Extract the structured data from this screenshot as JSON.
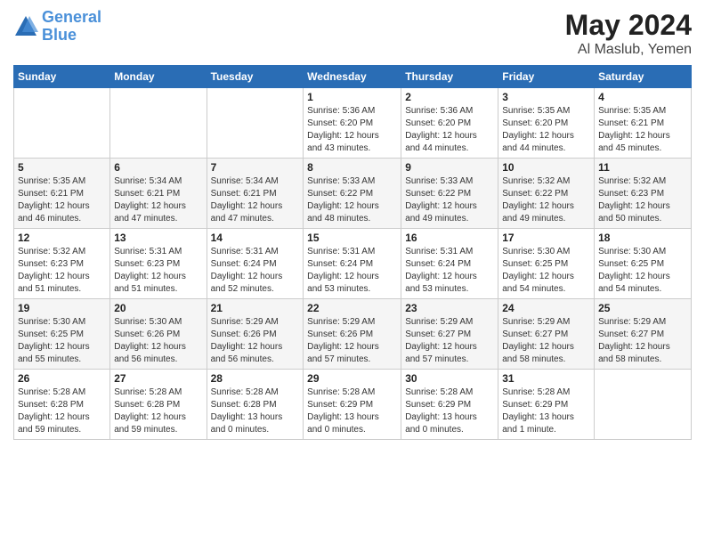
{
  "header": {
    "logo_line1": "General",
    "logo_line2": "Blue",
    "month": "May 2024",
    "location": "Al Maslub, Yemen"
  },
  "weekdays": [
    "Sunday",
    "Monday",
    "Tuesday",
    "Wednesday",
    "Thursday",
    "Friday",
    "Saturday"
  ],
  "weeks": [
    [
      {
        "day": "",
        "info": ""
      },
      {
        "day": "",
        "info": ""
      },
      {
        "day": "",
        "info": ""
      },
      {
        "day": "1",
        "info": "Sunrise: 5:36 AM\nSunset: 6:20 PM\nDaylight: 12 hours\nand 43 minutes."
      },
      {
        "day": "2",
        "info": "Sunrise: 5:36 AM\nSunset: 6:20 PM\nDaylight: 12 hours\nand 44 minutes."
      },
      {
        "day": "3",
        "info": "Sunrise: 5:35 AM\nSunset: 6:20 PM\nDaylight: 12 hours\nand 44 minutes."
      },
      {
        "day": "4",
        "info": "Sunrise: 5:35 AM\nSunset: 6:21 PM\nDaylight: 12 hours\nand 45 minutes."
      }
    ],
    [
      {
        "day": "5",
        "info": "Sunrise: 5:35 AM\nSunset: 6:21 PM\nDaylight: 12 hours\nand 46 minutes."
      },
      {
        "day": "6",
        "info": "Sunrise: 5:34 AM\nSunset: 6:21 PM\nDaylight: 12 hours\nand 47 minutes."
      },
      {
        "day": "7",
        "info": "Sunrise: 5:34 AM\nSunset: 6:21 PM\nDaylight: 12 hours\nand 47 minutes."
      },
      {
        "day": "8",
        "info": "Sunrise: 5:33 AM\nSunset: 6:22 PM\nDaylight: 12 hours\nand 48 minutes."
      },
      {
        "day": "9",
        "info": "Sunrise: 5:33 AM\nSunset: 6:22 PM\nDaylight: 12 hours\nand 49 minutes."
      },
      {
        "day": "10",
        "info": "Sunrise: 5:32 AM\nSunset: 6:22 PM\nDaylight: 12 hours\nand 49 minutes."
      },
      {
        "day": "11",
        "info": "Sunrise: 5:32 AM\nSunset: 6:23 PM\nDaylight: 12 hours\nand 50 minutes."
      }
    ],
    [
      {
        "day": "12",
        "info": "Sunrise: 5:32 AM\nSunset: 6:23 PM\nDaylight: 12 hours\nand 51 minutes."
      },
      {
        "day": "13",
        "info": "Sunrise: 5:31 AM\nSunset: 6:23 PM\nDaylight: 12 hours\nand 51 minutes."
      },
      {
        "day": "14",
        "info": "Sunrise: 5:31 AM\nSunset: 6:24 PM\nDaylight: 12 hours\nand 52 minutes."
      },
      {
        "day": "15",
        "info": "Sunrise: 5:31 AM\nSunset: 6:24 PM\nDaylight: 12 hours\nand 53 minutes."
      },
      {
        "day": "16",
        "info": "Sunrise: 5:31 AM\nSunset: 6:24 PM\nDaylight: 12 hours\nand 53 minutes."
      },
      {
        "day": "17",
        "info": "Sunrise: 5:30 AM\nSunset: 6:25 PM\nDaylight: 12 hours\nand 54 minutes."
      },
      {
        "day": "18",
        "info": "Sunrise: 5:30 AM\nSunset: 6:25 PM\nDaylight: 12 hours\nand 54 minutes."
      }
    ],
    [
      {
        "day": "19",
        "info": "Sunrise: 5:30 AM\nSunset: 6:25 PM\nDaylight: 12 hours\nand 55 minutes."
      },
      {
        "day": "20",
        "info": "Sunrise: 5:30 AM\nSunset: 6:26 PM\nDaylight: 12 hours\nand 56 minutes."
      },
      {
        "day": "21",
        "info": "Sunrise: 5:29 AM\nSunset: 6:26 PM\nDaylight: 12 hours\nand 56 minutes."
      },
      {
        "day": "22",
        "info": "Sunrise: 5:29 AM\nSunset: 6:26 PM\nDaylight: 12 hours\nand 57 minutes."
      },
      {
        "day": "23",
        "info": "Sunrise: 5:29 AM\nSunset: 6:27 PM\nDaylight: 12 hours\nand 57 minutes."
      },
      {
        "day": "24",
        "info": "Sunrise: 5:29 AM\nSunset: 6:27 PM\nDaylight: 12 hours\nand 58 minutes."
      },
      {
        "day": "25",
        "info": "Sunrise: 5:29 AM\nSunset: 6:27 PM\nDaylight: 12 hours\nand 58 minutes."
      }
    ],
    [
      {
        "day": "26",
        "info": "Sunrise: 5:28 AM\nSunset: 6:28 PM\nDaylight: 12 hours\nand 59 minutes."
      },
      {
        "day": "27",
        "info": "Sunrise: 5:28 AM\nSunset: 6:28 PM\nDaylight: 12 hours\nand 59 minutes."
      },
      {
        "day": "28",
        "info": "Sunrise: 5:28 AM\nSunset: 6:28 PM\nDaylight: 13 hours\nand 0 minutes."
      },
      {
        "day": "29",
        "info": "Sunrise: 5:28 AM\nSunset: 6:29 PM\nDaylight: 13 hours\nand 0 minutes."
      },
      {
        "day": "30",
        "info": "Sunrise: 5:28 AM\nSunset: 6:29 PM\nDaylight: 13 hours\nand 0 minutes."
      },
      {
        "day": "31",
        "info": "Sunrise: 5:28 AM\nSunset: 6:29 PM\nDaylight: 13 hours\nand 1 minute."
      },
      {
        "day": "",
        "info": ""
      }
    ]
  ]
}
